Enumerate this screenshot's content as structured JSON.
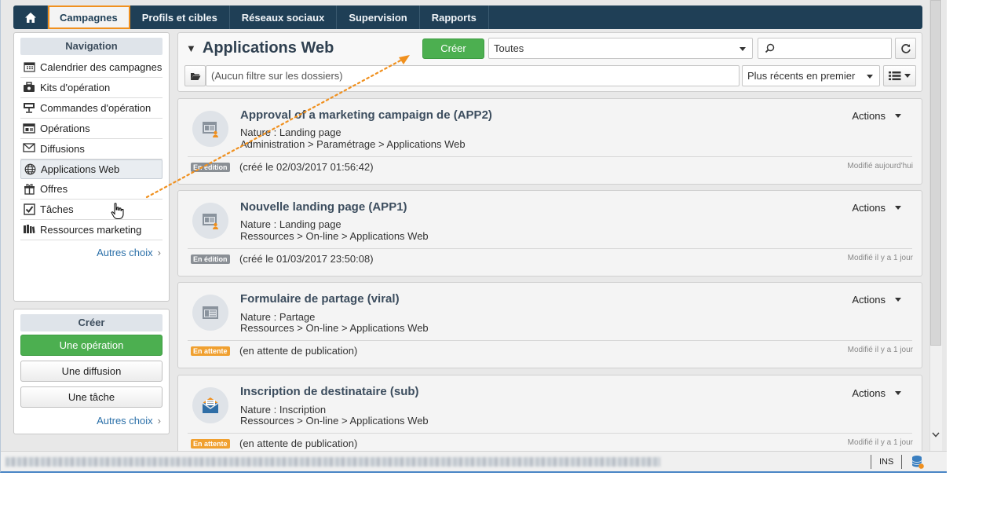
{
  "topnav": {
    "tabs": [
      {
        "label": "Campagnes",
        "active": true
      },
      {
        "label": "Profils et cibles"
      },
      {
        "label": "Réseaux sociaux"
      },
      {
        "label": "Supervision"
      },
      {
        "label": "Rapports"
      }
    ]
  },
  "sidebar": {
    "navigation": {
      "title": "Navigation",
      "items": [
        {
          "label": "Calendrier des campagnes",
          "icon": "calendar-icon"
        },
        {
          "label": "Kits d'opération",
          "icon": "kit-icon"
        },
        {
          "label": "Commandes d'opération",
          "icon": "order-icon"
        },
        {
          "label": "Opérations",
          "icon": "operations-icon"
        },
        {
          "label": "Diffusions",
          "icon": "envelope-icon"
        },
        {
          "label": "Applications Web",
          "icon": "globe-icon",
          "selected": true
        },
        {
          "label": "Offres",
          "icon": "gift-icon"
        },
        {
          "label": "Tâches",
          "icon": "checkbox-icon"
        },
        {
          "label": "Ressources marketing",
          "icon": "books-icon"
        }
      ],
      "more": "Autres choix"
    },
    "create": {
      "title": "Créer",
      "buttons": [
        "Une opération",
        "Une diffusion",
        "Une tâche"
      ],
      "more": "Autres choix"
    }
  },
  "main": {
    "title": "Applications Web",
    "create_label": "Créer",
    "filter_value": "Toutes",
    "search_value": "",
    "folder_filter_placeholder": "(Aucun filtre sur les dossiers)",
    "sort_value": "Plus récents en premier"
  },
  "cards": [
    {
      "title": "Approval of a marketing campaign de (APP2)",
      "nature": "Nature : Landing page",
      "path": "Administration > Paramétrage > Applications Web",
      "badge": "En édition",
      "badge_color": "#8a8f95",
      "created": "(créé le 02/03/2017 01:56:42)",
      "modified": "Modifié aujourd'hui",
      "actions": "Actions",
      "icon": "landing-page-icon"
    },
    {
      "title": "Nouvelle landing page (APP1)",
      "nature": "Nature : Landing page",
      "path": "Ressources > On-line > Applications Web",
      "badge": "En édition",
      "badge_color": "#8a8f95",
      "created": "(créé le 01/03/2017 23:50:08)",
      "modified": "Modifié il y a 1 jour",
      "actions": "Actions",
      "icon": "landing-page-icon"
    },
    {
      "title": "Formulaire de partage (viral)",
      "nature": "Nature : Partage",
      "path": "Ressources > On-line > Applications Web",
      "badge": "En attente",
      "badge_color": "#f0a030",
      "created": "(en attente de publication)",
      "modified": "Modifié il y a 1 jour",
      "actions": "Actions",
      "icon": "form-icon"
    },
    {
      "title": "Inscription de destinataire (sub)",
      "nature": "Nature : Inscription",
      "path": "Ressources > On-line > Applications Web",
      "badge": "En attente",
      "badge_color": "#f0a030",
      "created": "(en attente de publication)",
      "modified": "Modifié il y a 1 jour",
      "actions": "Actions",
      "icon": "subscription-icon"
    }
  ],
  "statusbar": {
    "ins": "INS"
  },
  "colors": {
    "nav_bg": "#1f3f56",
    "highlight": "#f0901e",
    "create_green": "#4caf50"
  }
}
